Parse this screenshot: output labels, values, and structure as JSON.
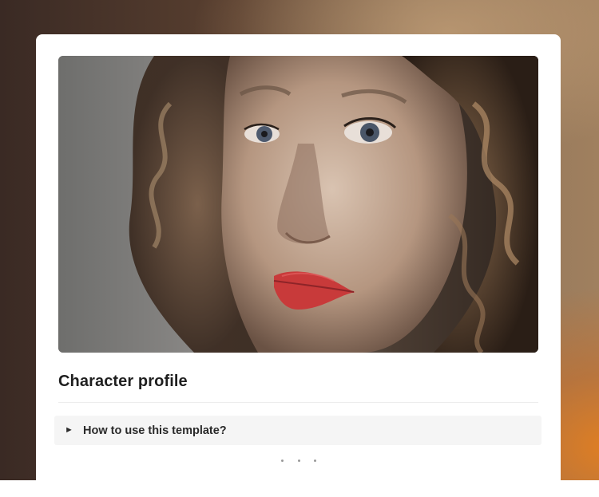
{
  "page": {
    "title": "Character profile"
  },
  "cover": {
    "alt": "Close-up portrait of a woman with curly hair and red lips",
    "icon": "cover-image"
  },
  "toggle": {
    "arrow": "►",
    "label": "How to use this template?",
    "expanded": false
  },
  "more": {
    "icon": "more-dots-icon"
  },
  "colors": {
    "card_bg": "#ffffff",
    "toggle_bg": "#f5f5f5",
    "text": "#1f1f1f",
    "accent_orange": "#e27e20"
  }
}
